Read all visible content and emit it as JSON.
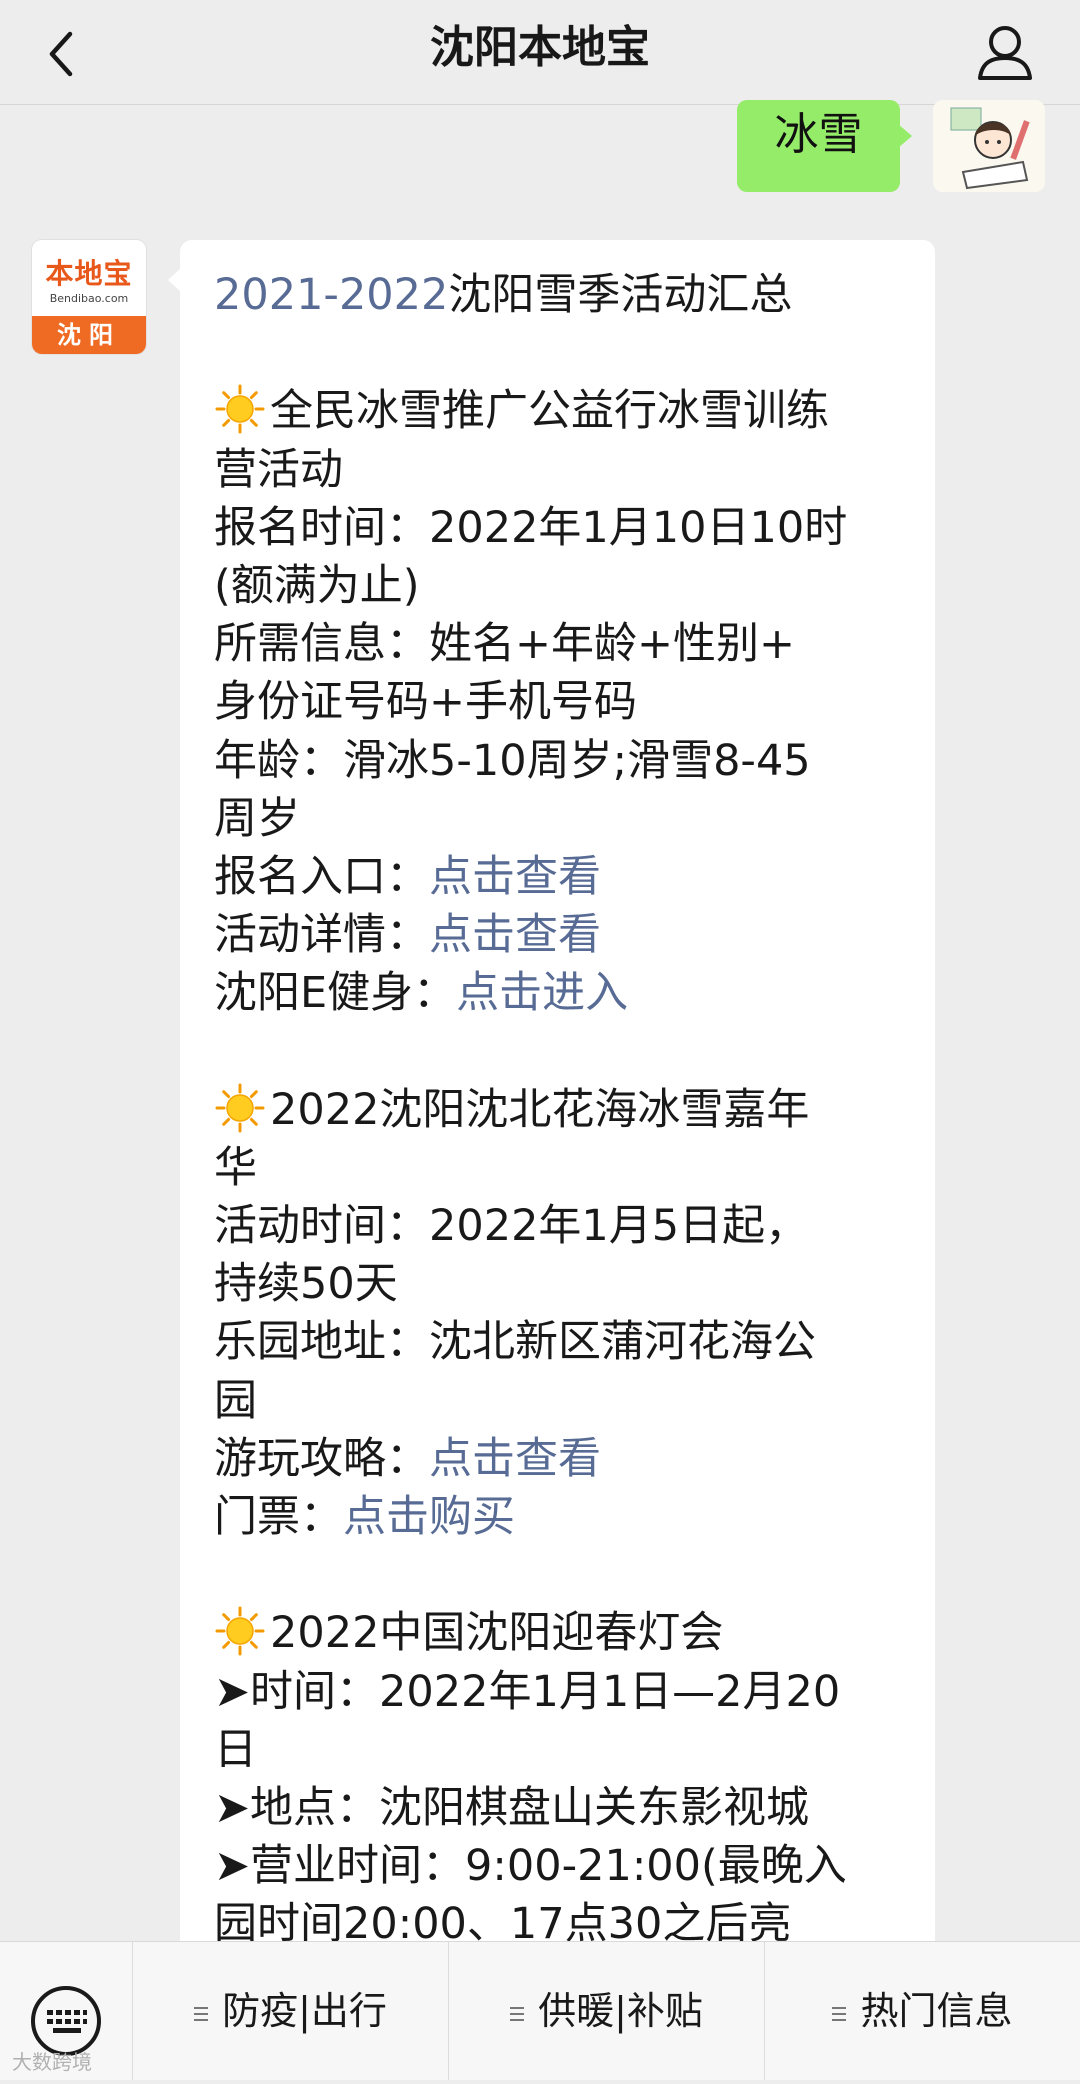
{
  "header": {
    "title": "沈阳本地宝"
  },
  "outgoing": {
    "text": "冰雪"
  },
  "account": {
    "logo_brand": "本地宝",
    "logo_domain": "Bendibao.com",
    "logo_city": "沈阳"
  },
  "message": {
    "title_year": "2021-2022",
    "title_rest": "沈阳雪季活动汇总",
    "s1_title_a": "全民冰雪推广公益行冰雪训练",
    "s1_title_b": "营活动",
    "s1_l1": "报名时间：2022年1月10日10时",
    "s1_l2": "(额满为止)",
    "s1_l3": "所需信息：姓名+年龄+性别+",
    "s1_l4": "身份证号码+手机号码",
    "s1_l5": "年龄：滑冰5-10周岁;滑雪8-45",
    "s1_l6": "周岁",
    "s1_reg_label": "报名入口：",
    "s1_reg_link": "点击查看",
    "s1_detail_label": "活动详情：",
    "s1_detail_link": "点击查看",
    "s1_e_label": "沈阳E健身：",
    "s1_e_link": "点击进入",
    "s2_title_a": "2022沈阳沈北花海冰雪嘉年",
    "s2_title_b": "华",
    "s2_l1": "活动时间：2022年1月5日起，",
    "s2_l2": "持续50天",
    "s2_l3": "乐园地址：沈北新区蒲河花海公",
    "s2_l4": "园",
    "s2_guide_label": "游玩攻略：",
    "s2_guide_link": "点击查看",
    "s2_ticket_label": "门票：",
    "s2_ticket_link": "点击购买",
    "s3_title": "2022中国沈阳迎春灯会",
    "s3_l1": "➤时间：2022年1月1日—2月20",
    "s3_l2": "日",
    "s3_l3": "➤地点：沈阳棋盘山关东影视城",
    "s3_l4": "➤营业时间：9:00-21:00(最晚入",
    "s3_l5": "园时间20:00、17点30之后亮"
  },
  "menu": {
    "items": [
      {
        "label": "防疫|出行"
      },
      {
        "label": "供暖|补贴"
      },
      {
        "label": "热门信息"
      }
    ]
  },
  "watermark": "大数跨境",
  "colors": {
    "link": "#576b95",
    "out_bubble": "#95ec69",
    "background": "#ededed"
  },
  "icons": [
    "back-arrow-icon",
    "profile-icon",
    "sun-emoji-icon",
    "keyboard-icon",
    "menu-lines-icon"
  ]
}
